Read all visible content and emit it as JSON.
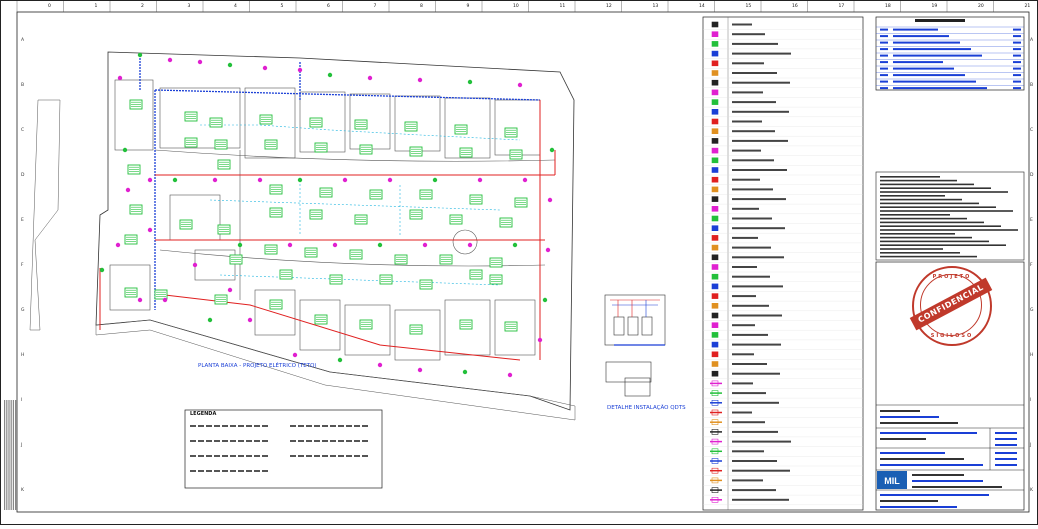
{
  "sheet": {
    "col_numbers": [
      "0",
      "1",
      "2",
      "3",
      "4",
      "5",
      "6",
      "7",
      "8",
      "9",
      "10",
      "11",
      "12",
      "13",
      "14",
      "15",
      "16",
      "17",
      "18",
      "19",
      "20",
      "21"
    ],
    "row_letters": [
      "A",
      "B",
      "C",
      "D",
      "E",
      "F",
      "G",
      "H",
      "I",
      "J",
      "K"
    ]
  },
  "plan": {
    "title": "PLANTA BAIXA - PROJETO ELÉTRICO (TETO)",
    "detail_title": "DETALHE INSTALAÇÃO QDTS"
  },
  "small_legend": {
    "heading": "LEGENDA"
  },
  "stamp": {
    "band": "CONFIDENCIAL",
    "top": "PROJETO",
    "bottom": "SIGILOSO"
  },
  "title_block": {
    "logo": "MIL"
  },
  "colors": {
    "wire_red": "#e02020",
    "wire_blue": "#1a3fd6",
    "fixture_green": "#22c03a",
    "device_magenta": "#e020d0",
    "stamp_red": "#c0392b"
  }
}
